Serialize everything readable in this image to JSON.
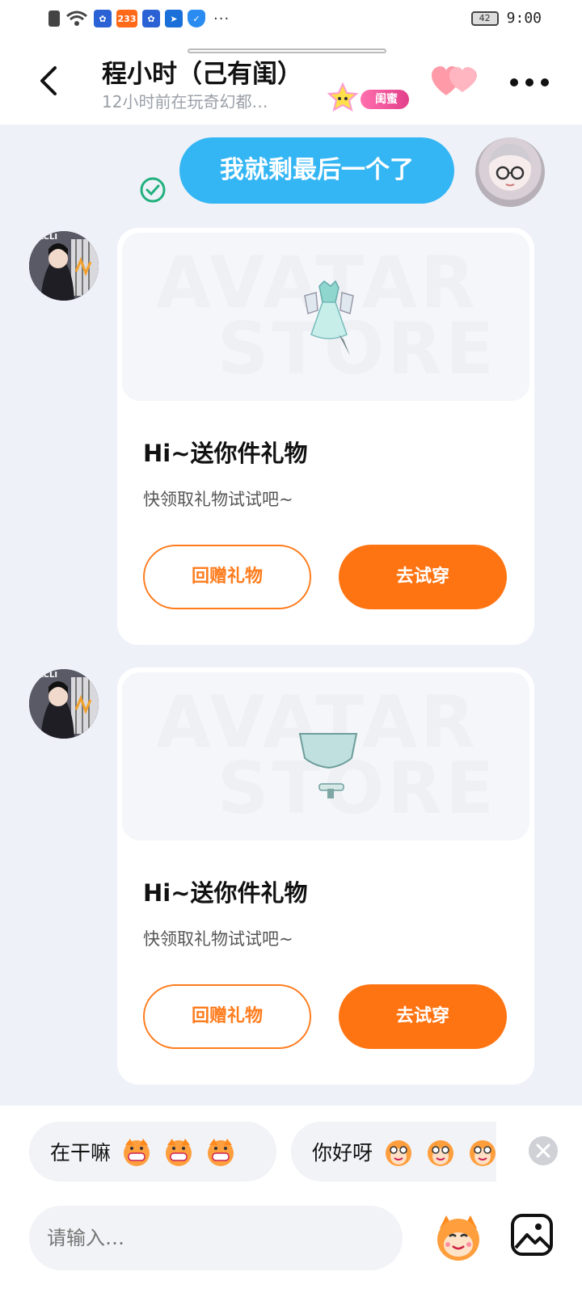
{
  "status_bar": {
    "app_badge": "233",
    "more": "···",
    "battery": "42",
    "time": "9:00"
  },
  "header": {
    "title": "程小时（己有闺）",
    "subtitle": "12小时前在玩奇幻都…",
    "badge": "闺蜜"
  },
  "chat": {
    "sent_message": "我就剩最后一个了",
    "gift_cards": [
      {
        "watermark_top": "AVATAR",
        "watermark_bottom": "STORE",
        "title": "Hi~送你件礼物",
        "subtitle": "快领取礼物试试吧~",
        "return_label": "回赠礼物",
        "try_label": "去试穿"
      },
      {
        "watermark_top": "AVATAR",
        "watermark_bottom": "STORE",
        "title": "Hi~送你件礼物",
        "subtitle": "快领取礼物试试吧~",
        "return_label": "回赠礼物",
        "try_label": "去试穿"
      }
    ],
    "avatar_text": "NKCLI"
  },
  "quick_replies": [
    {
      "text": "在干嘛",
      "icon": "grin-emoji-icon"
    },
    {
      "text": "你好呀",
      "icon": "smile-emoji-icon"
    }
  ],
  "composer": {
    "placeholder": "请输入…"
  },
  "colors": {
    "accent": "#ff7412",
    "bubble": "#35b6f4",
    "badge": "#e2408a"
  }
}
